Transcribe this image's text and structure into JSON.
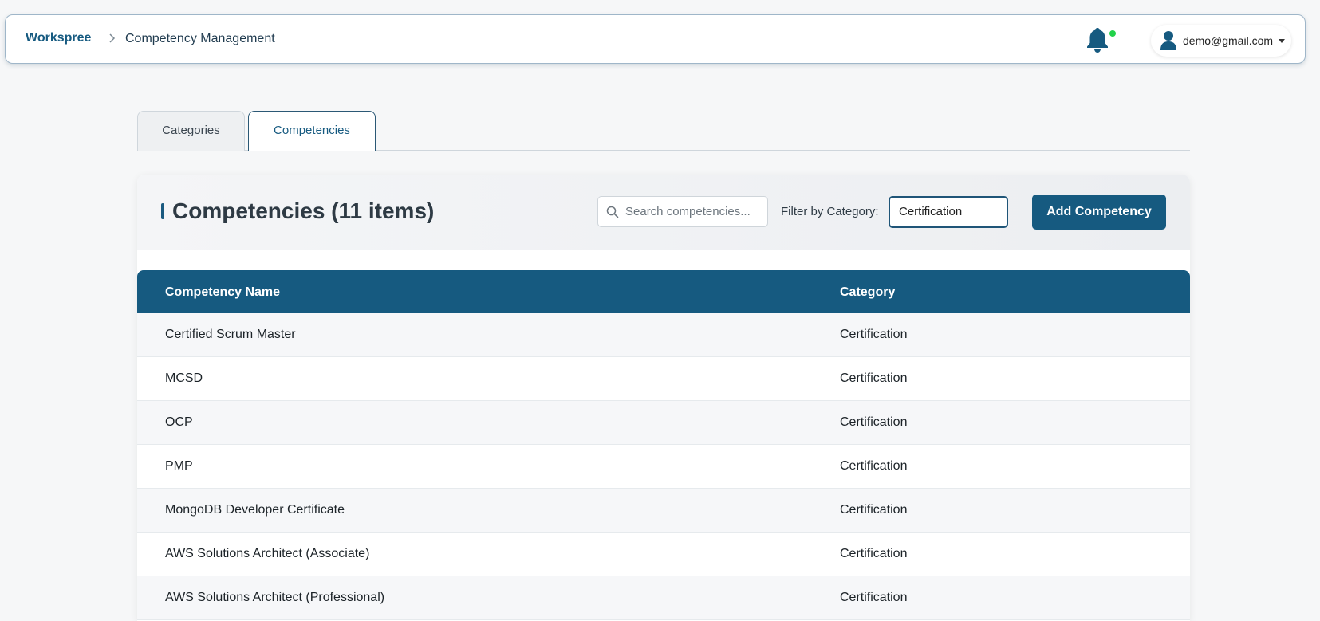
{
  "header": {
    "brand": "Workspree",
    "breadcrumb_current": "Competency Management",
    "user_email": "demo@gmail.com",
    "notification_dot_color": "#22d24a",
    "icons": [
      "chevron-right-icon",
      "bell-icon",
      "user-icon",
      "caret-down-icon"
    ]
  },
  "tabs": [
    {
      "label": "Categories",
      "active": false
    },
    {
      "label": "Competencies",
      "active": true
    }
  ],
  "panel": {
    "title": "Competencies (11 items)",
    "search_placeholder": "Search competencies...",
    "search_value": "",
    "filter_label": "Filter by Category:",
    "filter_value": "Certification",
    "add_button_label": "Add Competency"
  },
  "table": {
    "columns": [
      "Competency Name",
      "Category"
    ],
    "rows": [
      {
        "name": "Certified Scrum Master",
        "category": "Certification"
      },
      {
        "name": "MCSD",
        "category": "Certification"
      },
      {
        "name": "OCP",
        "category": "Certification"
      },
      {
        "name": "PMP",
        "category": "Certification"
      },
      {
        "name": "MongoDB Developer Certificate",
        "category": "Certification"
      },
      {
        "name": "AWS Solutions Architect (Associate)",
        "category": "Certification"
      },
      {
        "name": "AWS Solutions Architect (Professional)",
        "category": "Certification"
      }
    ]
  },
  "colors": {
    "primary": "#165a80",
    "background": "#f6f7f8"
  }
}
